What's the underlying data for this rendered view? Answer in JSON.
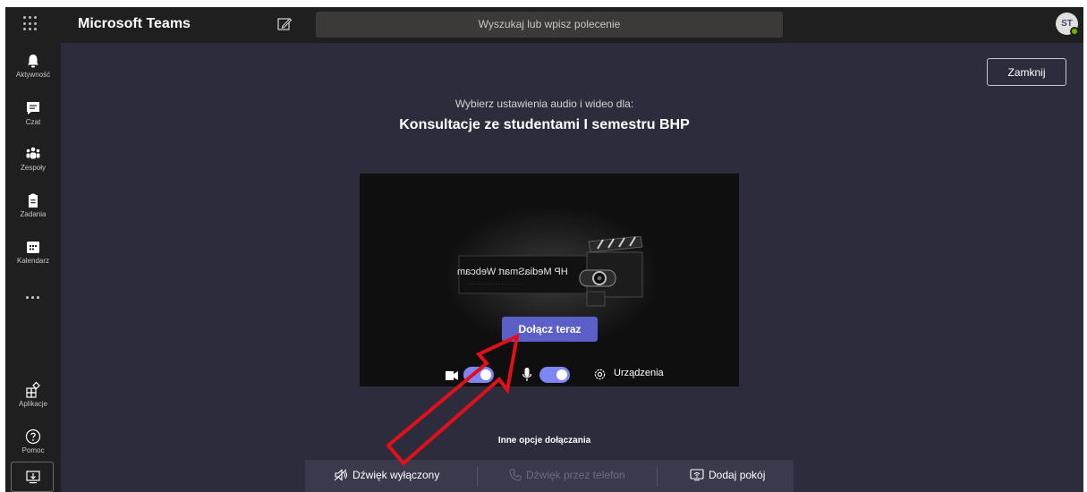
{
  "window": {
    "app_title": "Microsoft Teams",
    "search_placeholder": "Wyszukaj lub wpisz polecenie",
    "avatar_initials": "ST",
    "accent_color": "#5b5fc7"
  },
  "rail": {
    "items": [
      {
        "label": "Aktywność",
        "icon": "bell-icon"
      },
      {
        "label": "Czat",
        "icon": "chat-icon"
      },
      {
        "label": "Zespoły",
        "icon": "teams-icon"
      },
      {
        "label": "Zadania",
        "icon": "assignments-icon"
      },
      {
        "label": "Kalendarz",
        "icon": "calendar-icon"
      }
    ],
    "more": "...",
    "bottom_items": [
      {
        "label": "Aplikacje",
        "icon": "apps-icon"
      },
      {
        "label": "Pomoc",
        "icon": "help-icon"
      }
    ]
  },
  "prejoin": {
    "close_label": "Zamknij",
    "subtitle": "Wybierz ustawienia audio i wideo dla:",
    "meeting_title": "Konsultacje ze studentami I semestru BHP",
    "webcam_overlay_text": "HP MediaSmart Webcam",
    "join_label": "Dołącz teraz",
    "video_on": true,
    "mic_on": true,
    "devices_label": "Urządzenia",
    "other_options_title": "Inne opcje dołączania",
    "options": [
      {
        "label": "Dźwięk wyłączony",
        "icon": "speaker-off-icon",
        "enabled": true
      },
      {
        "label": "Dźwięk przez telefon",
        "icon": "phone-icon",
        "enabled": false
      },
      {
        "label": "Dodaj pokój",
        "icon": "cast-icon",
        "enabled": true
      }
    ]
  }
}
